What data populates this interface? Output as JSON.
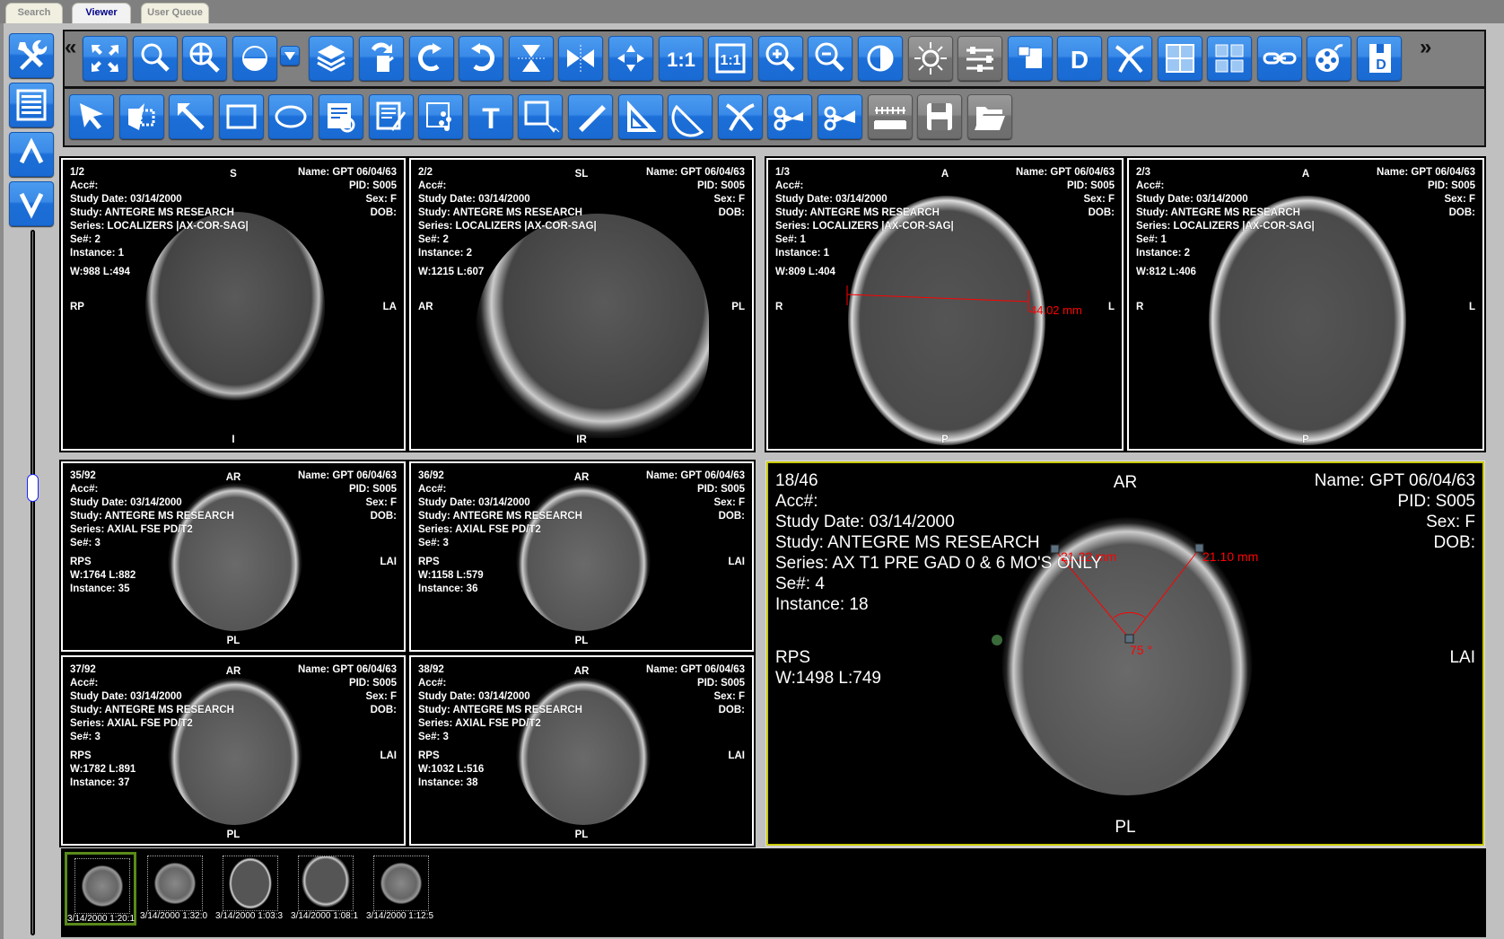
{
  "tabs": [
    {
      "label": "Search",
      "active": false
    },
    {
      "label": "Viewer",
      "active": true
    },
    {
      "label": "User Queue",
      "active": false
    }
  ],
  "left_toolbar": {
    "items": [
      {
        "icon": "tools-icon",
        "label": "Tools"
      },
      {
        "icon": "list-icon",
        "label": "Study list"
      },
      {
        "icon": "chevron-up-icon",
        "label": "Previous"
      },
      {
        "icon": "chevron-down-icon",
        "label": "Next"
      }
    ],
    "slider_value": 0.36
  },
  "toolbar": {
    "collapse_left": "«",
    "collapse_right": "»",
    "row1": [
      "fit-screen",
      "magnify",
      "pan-zoom",
      "window-level",
      "window-level-presets",
      "stack",
      "rotate-flip",
      "rotate-clockwise",
      "rotate-counterclockwise",
      "flip-vertical",
      "flip-horizontal",
      "center-image",
      "actual-size",
      "true-size",
      "zoom-in",
      "zoom-out",
      "invert",
      "brightness",
      "adjust",
      "copy",
      "dicom-info",
      "cross-reference",
      "layout-2x2",
      "layout-3x3",
      "link-series",
      "cine",
      "export-dicom"
    ],
    "row2": [
      "select",
      "select-region",
      "arrow",
      "rectangle",
      "ellipse",
      "annotation-note",
      "freehand-note",
      "point-cloud",
      "text",
      "roi-select",
      "ruler",
      "angle",
      "protractor",
      "clear-measurements",
      "cut-image",
      "cut-series",
      "calibration",
      "save",
      "open-folder"
    ]
  },
  "viewports": [
    {
      "id": "1/2",
      "top": "S",
      "bottom": "I",
      "left": "RP",
      "right": "LA",
      "acc": "Acc#:",
      "date": "Study Date: 03/14/2000",
      "study": "Study: ANTEGRE MS RESEARCH",
      "series": "Series: LOCALIZERS |AX-COR-SAG|",
      "se": "Se#: 2",
      "instance": "Instance: 1",
      "wl": "W:988 L:494",
      "name": "Name: GPT   06/04/63",
      "pid": "PID: S005",
      "sex": "Sex: F",
      "dob": "DOB:"
    },
    {
      "id": "2/2",
      "top": "SL",
      "bottom": "IR",
      "left": "AR",
      "right": "PL",
      "acc": "Acc#:",
      "date": "Study Date: 03/14/2000",
      "study": "Study: ANTEGRE MS RESEARCH",
      "series": "Series: LOCALIZERS |AX-COR-SAG|",
      "se": "Se#: 2",
      "instance": "Instance: 2",
      "wl": "W:1215 L:607",
      "name": "Name: GPT   06/04/63",
      "pid": "PID: S005",
      "sex": "Sex: F",
      "dob": "DOB:"
    },
    {
      "id": "1/3",
      "top": "A",
      "bottom": "P",
      "left": "R",
      "right": "L",
      "acc": "Acc#:",
      "date": "Study Date: 03/14/2000",
      "study": "Study: ANTEGRE MS RESEARCH",
      "series": "Series: LOCALIZERS |AX-COR-SAG|",
      "se": "Se#: 1",
      "instance": "Instance: 1",
      "wl": "W:809 L:404",
      "name": "Name: GPT   06/04/63",
      "pid": "PID: S005",
      "sex": "Sex: F",
      "dob": "DOB:",
      "measurement": "44.02 mm"
    },
    {
      "id": "2/3",
      "top": "A",
      "bottom": "P",
      "left": "R",
      "right": "L",
      "acc": "Acc#:",
      "date": "Study Date: 03/14/2000",
      "study": "Study: ANTEGRE MS RESEARCH",
      "series": "Series: LOCALIZERS |AX-COR-SAG|",
      "se": "Se#: 1",
      "instance": "Instance: 2",
      "wl": "W:812 L:406",
      "name": "Name: GPT   06/04/63",
      "pid": "PID: S005",
      "sex": "Sex: F",
      "dob": "DOB:"
    },
    {
      "id": "35/92",
      "top": "AR",
      "bottom": "PL",
      "left": "RPS",
      "right": "LAI",
      "acc": "Acc#:",
      "date": "Study Date: 03/14/2000",
      "study": "Study: ANTEGRE MS RESEARCH",
      "series": "Series: AXIAL FSE PD/T2",
      "se": "Se#: 3",
      "wl": "W:1764 L:882",
      "instance": "Instance: 35",
      "name": "Name: GPT   06/04/63",
      "pid": "PID: S005",
      "sex": "Sex: F",
      "dob": "DOB:"
    },
    {
      "id": "36/92",
      "top": "AR",
      "bottom": "PL",
      "left": "RPS",
      "right": "LAI",
      "acc": "Acc#:",
      "date": "Study Date: 03/14/2000",
      "study": "Study: ANTEGRE MS RESEARCH",
      "series": "Series: AXIAL FSE PD/T2",
      "se": "Se#: 3",
      "wl": "W:1158 L:579",
      "instance": "Instance: 36",
      "name": "Name: GPT   06/04/63",
      "pid": "PID: S005",
      "sex": "Sex: F",
      "dob": "DOB:"
    },
    {
      "id": "37/92",
      "top": "AR",
      "bottom": "PL",
      "left": "RPS",
      "right": "LAI",
      "acc": "Acc#:",
      "date": "Study Date: 03/14/2000",
      "study": "Study: ANTEGRE MS RESEARCH",
      "series": "Series: AXIAL FSE PD/T2",
      "se": "Se#: 3",
      "wl": "W:1782 L:891",
      "instance": "Instance: 37",
      "name": "Name: GPT   06/04/63",
      "pid": "PID: S005",
      "sex": "Sex: F",
      "dob": "DOB:"
    },
    {
      "id": "38/92",
      "top": "AR",
      "bottom": "PL",
      "left": "RPS",
      "right": "LAI",
      "acc": "Acc#:",
      "date": "Study Date: 03/14/2000",
      "study": "Study: ANTEGRE MS RESEARCH",
      "series": "Series: AXIAL FSE PD/T2",
      "se": "Se#: 3",
      "wl": "W:1032 L:516",
      "instance": "Instance: 38",
      "name": "Name: GPT   06/04/63",
      "pid": "PID: S005",
      "sex": "Sex: F",
      "dob": "DOB:"
    },
    {
      "id": "18/46",
      "top": "AR",
      "bottom": "PL",
      "left": "RPS",
      "right": "LAI",
      "acc": "Acc#:",
      "date": "Study Date: 03/14/2000",
      "study": "Study: ANTEGRE MS RESEARCH",
      "series": "Series: AX T1 PRE GAD 0 & 6 MO'S ONLY",
      "se": "Se#: 4",
      "instance": "Instance: 18",
      "wl": "W:1498 L:749",
      "name": "Name: GPT   06/04/63",
      "pid": "PID: S005",
      "sex": "Sex: F",
      "dob": "DOB:",
      "measurement_left": "21.22 mm",
      "measurement_right": "21.10 mm",
      "angle": "75 °",
      "selected": true
    }
  ],
  "thumbnails": [
    {
      "label": "3/14/2000 1:20:1",
      "selected": true
    },
    {
      "label": "3/14/2000 1:32:0",
      "selected": false
    },
    {
      "label": "3/14/2000 1:03:3",
      "selected": false
    },
    {
      "label": "3/14/2000 1:08:1",
      "selected": false
    },
    {
      "label": "3/14/2000 1:12:5",
      "selected": false
    }
  ],
  "colors": {
    "button_blue": "#1a6ad2",
    "selected_viewport": "#c8c800",
    "measurement": "#ff0000",
    "thumb_selected": "#5a8a1a"
  }
}
